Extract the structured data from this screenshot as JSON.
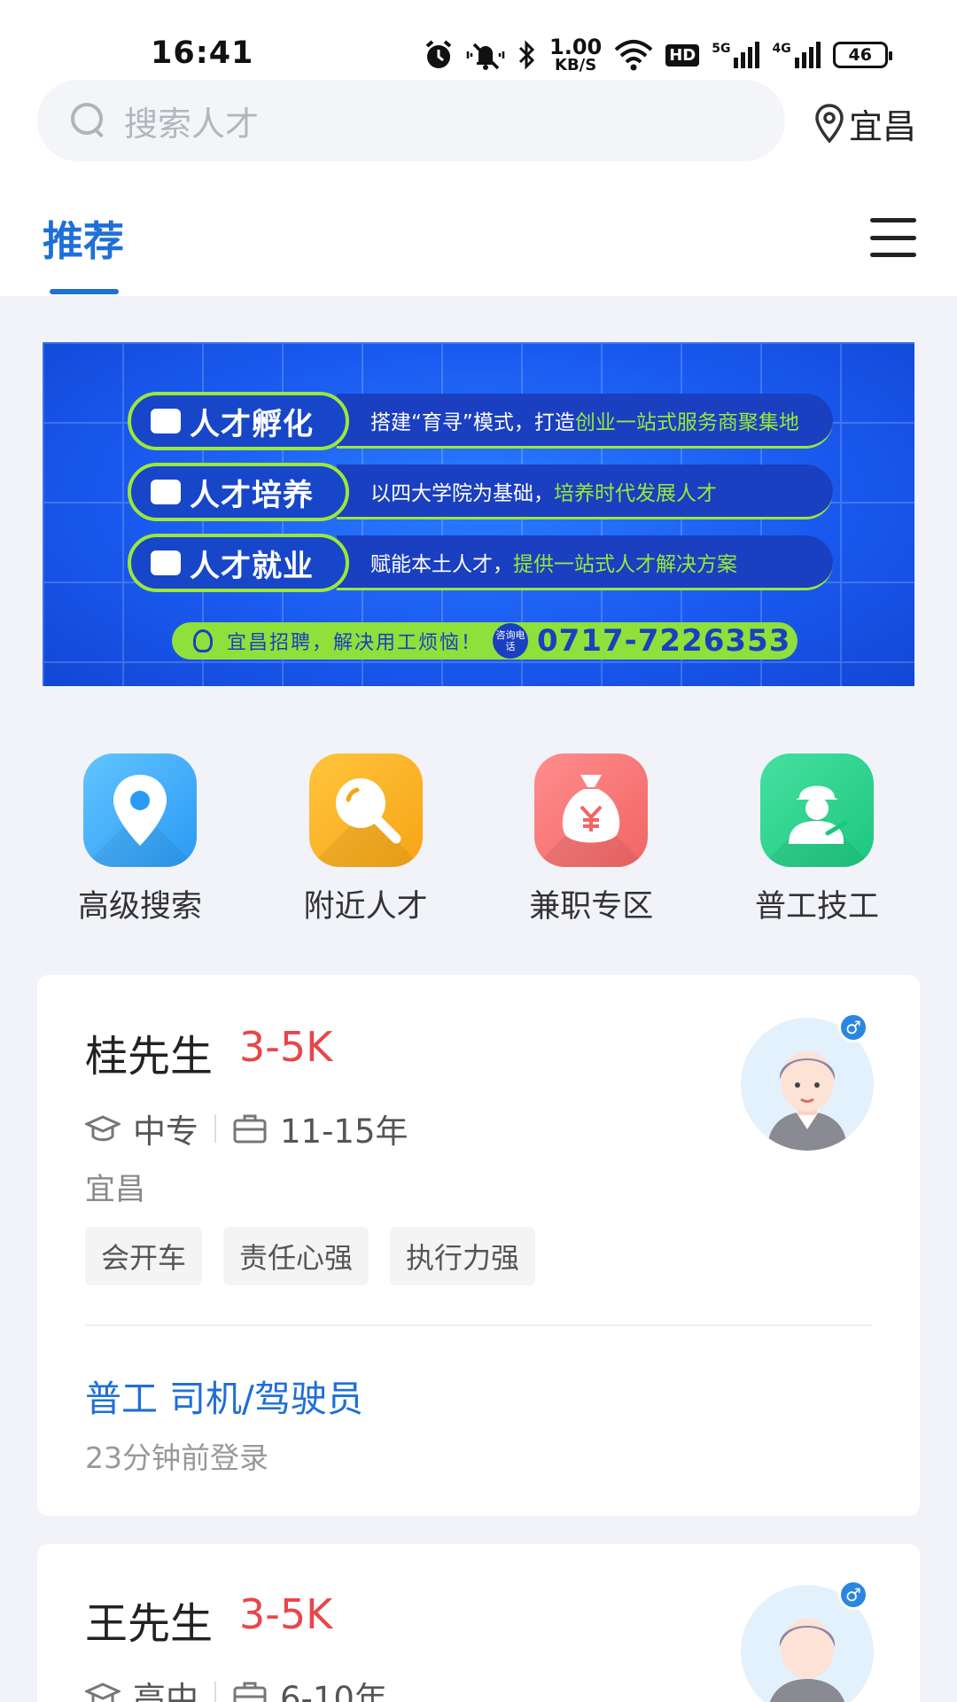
{
  "status_bar": {
    "time": "16:41",
    "net_speed_value": "1.00",
    "net_speed_unit": "KB/S",
    "hd_label": "HD",
    "sim1_label": "5G",
    "sim2_label": "4G",
    "battery": "46"
  },
  "search": {
    "placeholder": "搜索人才"
  },
  "location": {
    "city": "宜昌"
  },
  "tabs": [
    {
      "label": "推荐",
      "active": true
    }
  ],
  "banner": {
    "rows": [
      {
        "title": "人才孵化",
        "desc_plain": "搭建“育寻”模式，打造",
        "desc_highlight": "创业一站式服务商聚集地"
      },
      {
        "title": "人才培养",
        "desc_plain": "以四大学院为基础，",
        "desc_highlight": "培养时代发展人才"
      },
      {
        "title": "人才就业",
        "desc_plain": "赋能本土人才，",
        "desc_highlight": "提供一站式人才解决方案"
      }
    ],
    "slogan": "宜昌招聘，解决用工烦恼！",
    "consult_label": "咨询电话",
    "phone": "0717-7226353"
  },
  "quick_entries": [
    {
      "label": "高级搜索",
      "icon": "location-pin-icon",
      "color": "#2a9af5"
    },
    {
      "label": "附近人才",
      "icon": "magnifier-icon",
      "color": "#f7a416"
    },
    {
      "label": "兼职专区",
      "icon": "money-bag-icon",
      "color": "#f26565"
    },
    {
      "label": "普工技工",
      "icon": "worker-icon",
      "color": "#1ec77f"
    }
  ],
  "candidates": [
    {
      "name": "桂先生",
      "salary": "3-5K",
      "education": "中专",
      "experience": "11-15年",
      "city": "宜昌",
      "tags": [
        "会开车",
        "责任心强",
        "执行力强"
      ],
      "job": "普工 司机/驾驶员",
      "last_login": "23分钟前登录",
      "gender": "♂"
    },
    {
      "name": "王先生",
      "salary": "3-5K",
      "education": "高中",
      "experience": "6-10年",
      "gender": "♂"
    }
  ]
}
